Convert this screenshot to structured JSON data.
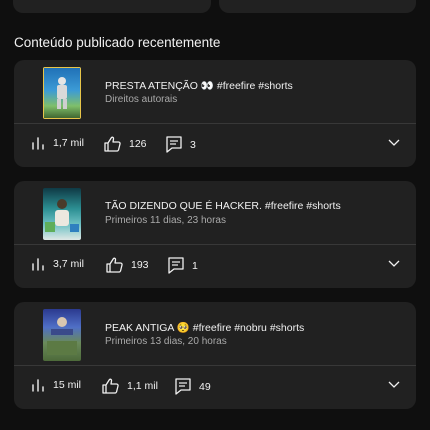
{
  "section_title": "Conteúdo publicado recentemente",
  "videos": [
    {
      "title": "PRESTA ATENÇÃO 👀        #freefire #shorts",
      "subtitle": "Direitos autorais",
      "views": "1,7 mil",
      "likes": "126",
      "comments": "3"
    },
    {
      "title": "TÃO DIZENDO QUE É HACKER. #freefire #shorts",
      "subtitle": "Primeiros 11 dias, 23 horas",
      "views": "3,7 mil",
      "likes": "193",
      "comments": "1"
    },
    {
      "title": "PEAK ANTIGA 🥺          #freefire #nobru #shorts",
      "subtitle": "Primeiros 13 dias, 20 horas",
      "views": "15 mil",
      "likes": "1,1 mil",
      "comments": "49"
    }
  ]
}
